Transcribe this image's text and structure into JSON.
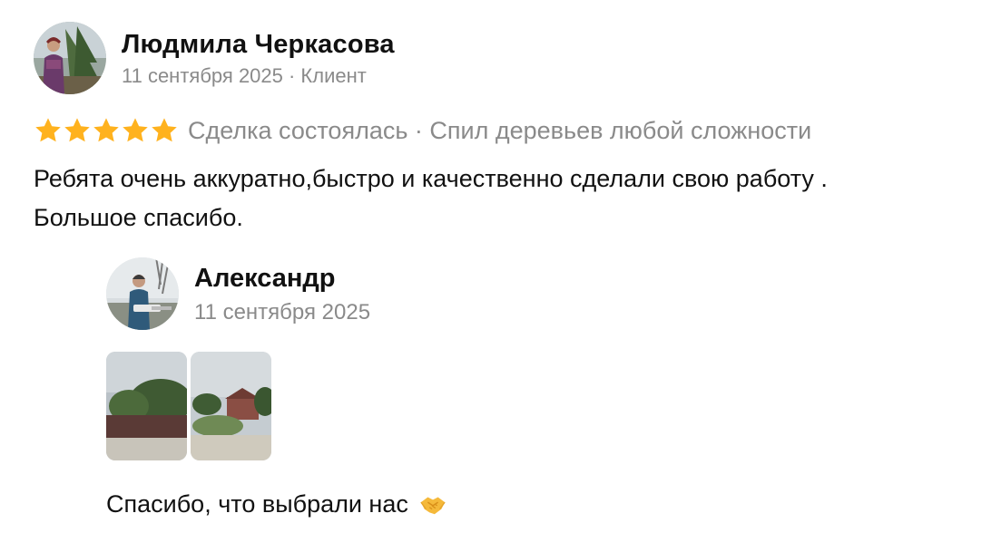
{
  "review": {
    "author": "Людмила Черкасова",
    "subtitle": "11 сентября 2025 · Клиент",
    "stars": 5,
    "star_color": "#ffb21e",
    "rating_text": "Сделка состоялась · Спил деревьев любой сложности",
    "body_line1": "Ребята очень аккуратно,быстро и качественно сделали свою работу .",
    "body_line2": "Большое спасибо."
  },
  "reply": {
    "author": "Александр",
    "date": "11 сентября 2025",
    "photo_count": 2,
    "text": "Спасибо, что выбрали нас",
    "emoji_icon": "handshake-icon"
  },
  "colors": {
    "text": "#111111",
    "muted": "#8a8a8a",
    "star": "#ffb21e"
  }
}
